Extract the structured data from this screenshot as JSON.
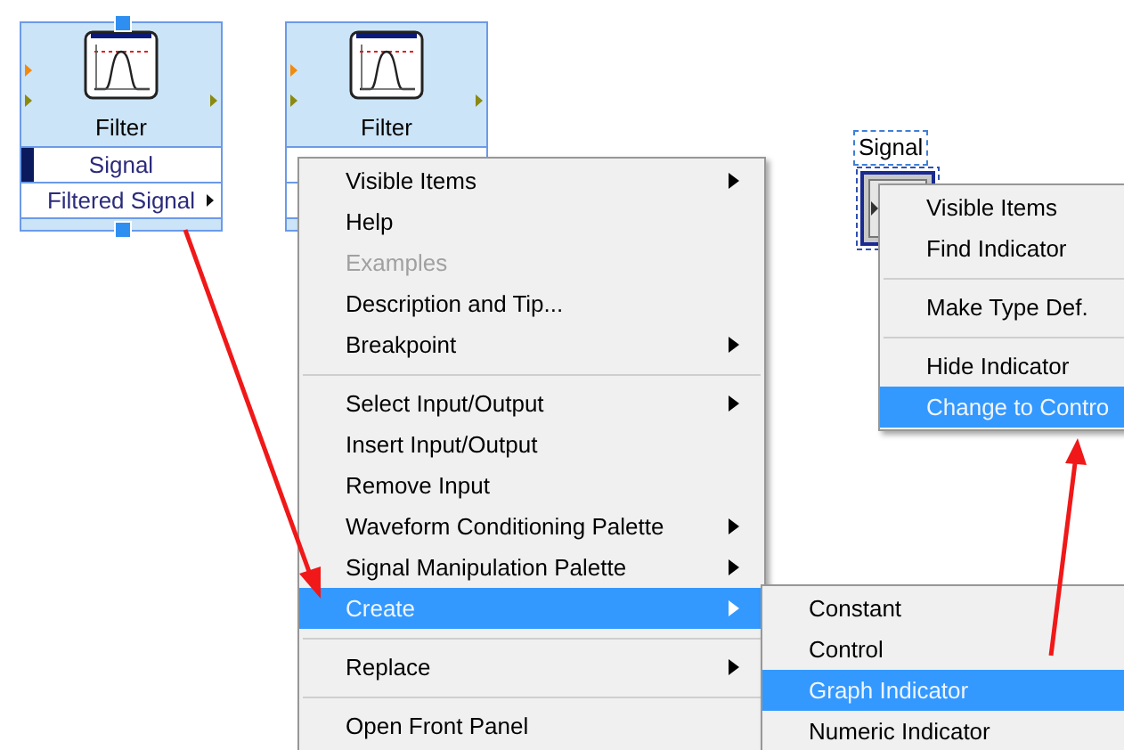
{
  "nodes": [
    {
      "title": "Filter",
      "selected": true,
      "terminals": [
        {
          "label": "Signal",
          "wired": true,
          "has_output": false
        },
        {
          "label": "Filtered Signal",
          "wired": false,
          "has_output": true
        }
      ]
    },
    {
      "title": "Filter",
      "selected": false
    }
  ],
  "indicator": {
    "label": "Signal",
    "selected": true
  },
  "context_menu": {
    "items": [
      {
        "kind": "item",
        "label": "Visible Items",
        "submenu": true,
        "disabled": false,
        "selected": false
      },
      {
        "kind": "item",
        "label": "Help",
        "submenu": false,
        "disabled": false,
        "selected": false
      },
      {
        "kind": "item",
        "label": "Examples",
        "submenu": false,
        "disabled": true,
        "selected": false
      },
      {
        "kind": "item",
        "label": "Description and Tip...",
        "submenu": false,
        "disabled": false,
        "selected": false
      },
      {
        "kind": "item",
        "label": "Breakpoint",
        "submenu": true,
        "disabled": false,
        "selected": false
      },
      {
        "kind": "separator"
      },
      {
        "kind": "item",
        "label": "Select Input/Output",
        "submenu": true,
        "disabled": false,
        "selected": false
      },
      {
        "kind": "item",
        "label": "Insert Input/Output",
        "submenu": false,
        "disabled": false,
        "selected": false
      },
      {
        "kind": "item",
        "label": "Remove Input",
        "submenu": false,
        "disabled": false,
        "selected": false
      },
      {
        "kind": "item",
        "label": "Waveform Conditioning Palette",
        "submenu": true,
        "disabled": false,
        "selected": false
      },
      {
        "kind": "item",
        "label": "Signal Manipulation Palette",
        "submenu": true,
        "disabled": false,
        "selected": false
      },
      {
        "kind": "item",
        "label": "Create",
        "submenu": true,
        "disabled": false,
        "selected": true
      },
      {
        "kind": "separator"
      },
      {
        "kind": "item",
        "label": "Replace",
        "submenu": true,
        "disabled": false,
        "selected": false
      },
      {
        "kind": "separator"
      },
      {
        "kind": "item",
        "label": "Open Front Panel",
        "submenu": false,
        "disabled": false,
        "selected": false
      }
    ]
  },
  "create_submenu": {
    "items": [
      {
        "kind": "item",
        "label": "Constant",
        "submenu": false,
        "disabled": false,
        "selected": false
      },
      {
        "kind": "item",
        "label": "Control",
        "submenu": false,
        "disabled": false,
        "selected": false
      },
      {
        "kind": "item",
        "label": "Graph Indicator",
        "submenu": false,
        "disabled": false,
        "selected": true
      },
      {
        "kind": "item",
        "label": "Numeric Indicator",
        "submenu": false,
        "disabled": false,
        "selected": false
      }
    ]
  },
  "indicator_menu": {
    "items": [
      {
        "kind": "item",
        "label": "Visible Items",
        "submenu": false,
        "disabled": false,
        "selected": false
      },
      {
        "kind": "item",
        "label": "Find Indicator",
        "submenu": false,
        "disabled": false,
        "selected": false
      },
      {
        "kind": "separator"
      },
      {
        "kind": "item",
        "label": "Make Type Def.",
        "submenu": false,
        "disabled": false,
        "selected": false
      },
      {
        "kind": "separator"
      },
      {
        "kind": "item",
        "label": "Hide Indicator",
        "submenu": false,
        "disabled": false,
        "selected": false
      },
      {
        "kind": "item",
        "label": "Change to Contro",
        "submenu": false,
        "disabled": false,
        "selected": true
      }
    ]
  }
}
